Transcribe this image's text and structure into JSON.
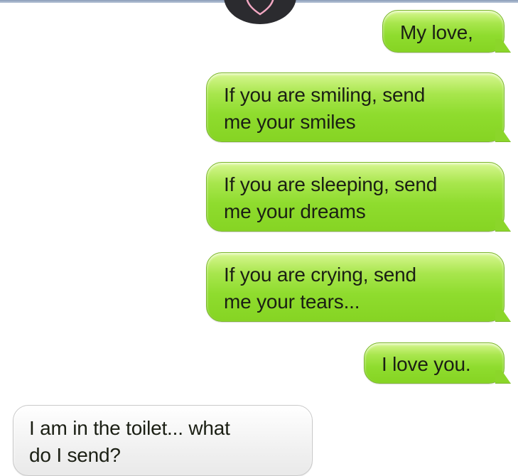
{
  "conversation": {
    "sent_messages": [
      {
        "text": "My love,"
      },
      {
        "text": "If you are smiling, send\nme your smiles"
      },
      {
        "text": "If you are sleeping, send\nme your dreams"
      },
      {
        "text": "If you are crying, send\nme your tears..."
      },
      {
        "text": "I love you."
      }
    ],
    "received_messages": [
      {
        "text": "I am in the toilet... what\ndo I send?"
      }
    ]
  },
  "colors": {
    "sent_bubble": "#8fdc2e",
    "received_bubble": "#f1f1f1",
    "avatar_bg": "#2b2b2f",
    "heart_outline": "#f2a7c2"
  },
  "icons": {
    "avatar": "heart-icon"
  }
}
